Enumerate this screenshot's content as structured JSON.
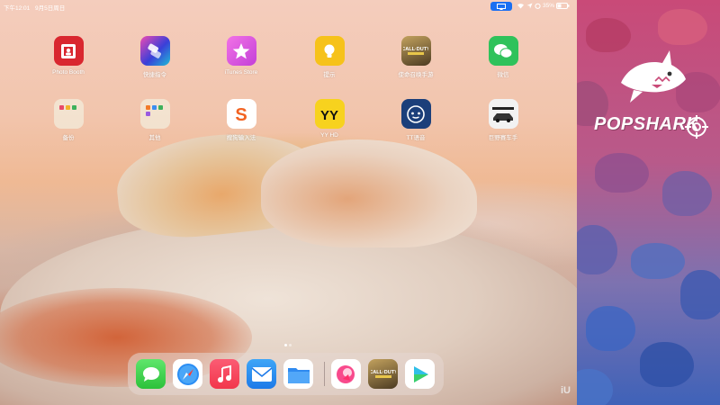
{
  "status_bar": {
    "time": "下午12:01",
    "date": "9月5日周日",
    "battery": "35%",
    "icons": [
      "screen-mirror-icon",
      "wifi-icon",
      "location-icon",
      "alarm-icon",
      "battery-icon"
    ]
  },
  "home_apps": [
    {
      "label": "Photo Booth",
      "icon": "photo-booth-icon",
      "color": "#d9272f"
    },
    {
      "label": "快捷指令",
      "icon": "shortcuts-icon",
      "color": "#3a3fd8"
    },
    {
      "label": "iTunes Store",
      "icon": "itunes-store-icon",
      "color": "#e64fd6"
    },
    {
      "label": "提示",
      "icon": "tips-icon",
      "color": "#f6c21a"
    },
    {
      "label": "使命召唤手游",
      "icon": "call-of-duty-icon",
      "color": "#5a4a2a"
    },
    {
      "label": "微信",
      "icon": "wechat-icon",
      "color": "#2fc25b"
    },
    {
      "label": "备份",
      "icon": "folder-icon",
      "color": "#f3ead8"
    },
    {
      "label": "其他",
      "icon": "folder-icon",
      "color": "#f3ead8"
    },
    {
      "label": "搜狗输入法",
      "icon": "sogou-icon",
      "color": "#ffffff"
    },
    {
      "label": "YY HD",
      "icon": "yy-icon",
      "color": "#f7d21e"
    },
    {
      "label": "TT语音",
      "icon": "tt-voice-icon",
      "color": "#1c3f7a"
    },
    {
      "label": "巨野赛车手",
      "icon": "racing-game-icon",
      "color": "#f2f2f2"
    }
  ],
  "dock": {
    "apps": [
      {
        "name": "messages",
        "icon": "messages-icon",
        "color": "#3fd14e"
      },
      {
        "name": "safari",
        "icon": "safari-icon",
        "color": "#ffffff"
      },
      {
        "name": "music",
        "icon": "music-icon",
        "color": "#f1384c"
      },
      {
        "name": "mail",
        "icon": "mail-icon",
        "color": "#2d8ff0"
      },
      {
        "name": "files",
        "icon": "files-icon",
        "color": "#ffffff"
      },
      {
        "name": "douyin-live",
        "icon": "live-app-icon",
        "color": "#ffffff"
      },
      {
        "name": "call-of-duty",
        "icon": "call-of-duty-icon",
        "color": "#5a4a2a"
      },
      {
        "name": "video-player",
        "icon": "video-player-icon",
        "color": "#ffffff"
      }
    ]
  },
  "watermark": "iU",
  "sidebar": {
    "brand": "POPSHARK",
    "colors": {
      "top": "#c94a78",
      "bottom": "#3f62b8"
    }
  }
}
